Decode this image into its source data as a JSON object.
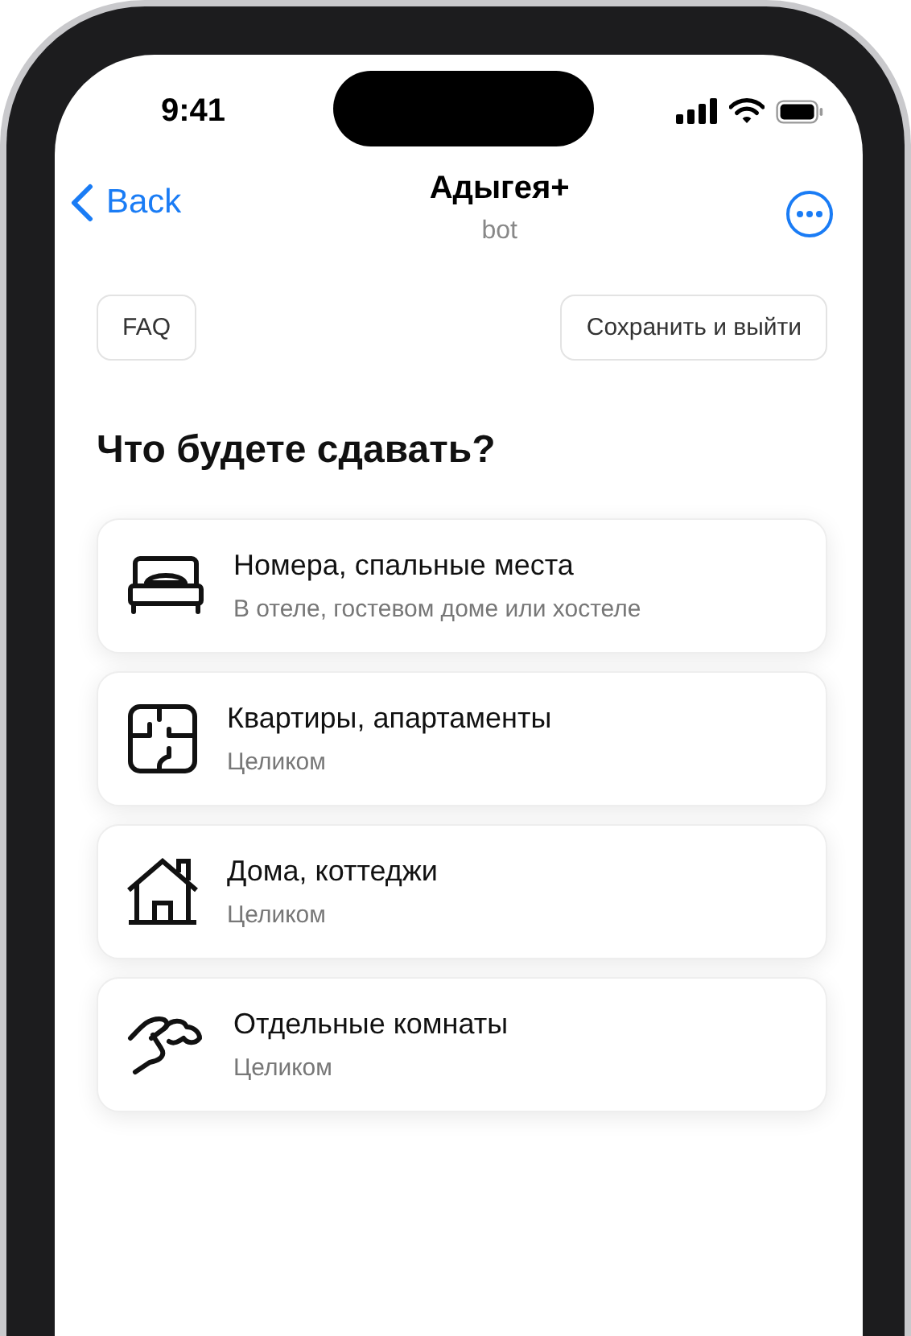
{
  "status_bar": {
    "time": "9:41"
  },
  "nav": {
    "back": "Back",
    "title": "Адыгея+",
    "subtitle": "bot"
  },
  "top_buttons": [
    "FAQ",
    "Сохранить и выйти"
  ],
  "heading": "Что будете сдавать?",
  "options": [
    {
      "kind": "bed",
      "title": "Номера, спальные места",
      "subtitle": "В отеле, гостевом доме или хостеле"
    },
    {
      "kind": "floorplan",
      "title": "Квартиры, апартаменты",
      "subtitle": "Целиком"
    },
    {
      "kind": "house",
      "title": "Дома, коттеджи",
      "subtitle": "Целиком"
    },
    {
      "kind": "hand",
      "title": "Отдельные комнаты",
      "subtitle": "Целиком"
    }
  ]
}
